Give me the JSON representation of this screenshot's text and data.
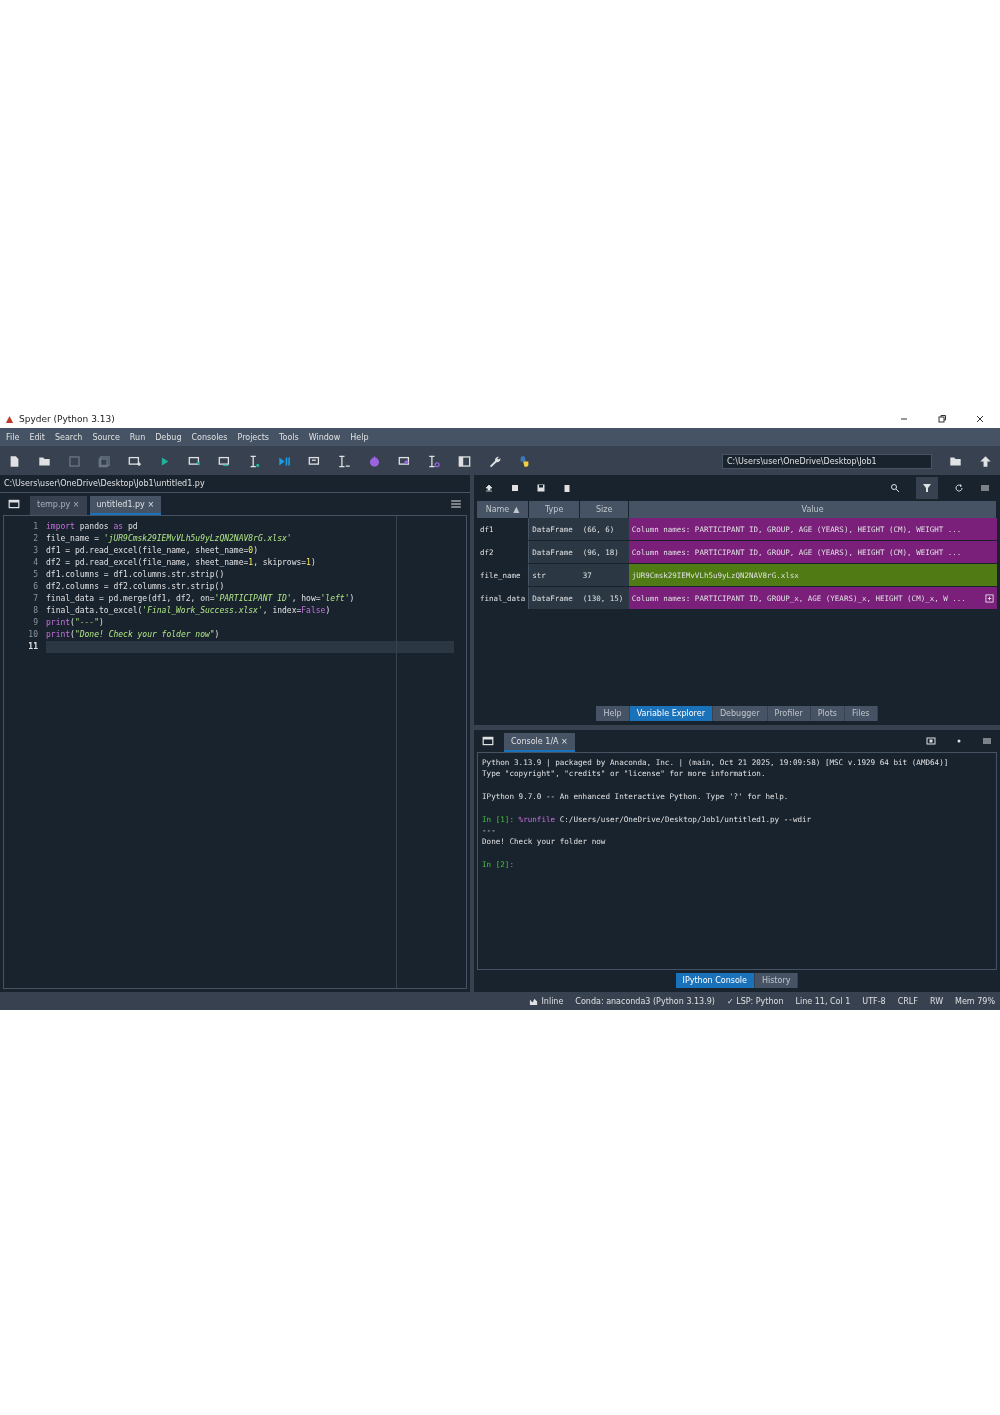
{
  "window": {
    "title": "Spyder (Python 3.13)"
  },
  "menu": [
    "File",
    "Edit",
    "Search",
    "Source",
    "Run",
    "Debug",
    "Consoles",
    "Projects",
    "Tools",
    "Window",
    "Help"
  ],
  "working_directory": {
    "value": "C:\\Users\\user\\OneDrive\\Desktop\\Job1"
  },
  "editor": {
    "path": "C:\\Users\\user\\OneDrive\\Desktop\\Job1\\untitled1.py",
    "tabs": [
      {
        "label": "temp.py",
        "close": "×",
        "selected": false
      },
      {
        "label": "untitled1.py",
        "close": "×",
        "selected": true
      }
    ],
    "lines": [
      {
        "number": "1",
        "current": false,
        "tokens": [
          {
            "kind": "keyword",
            "text": "import"
          },
          {
            "kind": "plain",
            "text": " pandos "
          },
          {
            "kind": "keyword",
            "text": "as"
          },
          {
            "kind": "plain",
            "text": " pd"
          }
        ]
      },
      {
        "number": "2",
        "current": false,
        "tokens": [
          {
            "kind": "plain",
            "text": "file_name = "
          },
          {
            "kind": "string",
            "text": "'jUR9Cmsk29IEMvVLh5u9yLzQN2NAV8rG.xlsx'"
          }
        ]
      },
      {
        "number": "3",
        "current": false,
        "tokens": [
          {
            "kind": "plain",
            "text": "df1 = pd.read_excel(file_name, sheet_name="
          },
          {
            "kind": "number",
            "text": "0"
          },
          {
            "kind": "plain",
            "text": ")"
          }
        ]
      },
      {
        "number": "4",
        "current": false,
        "tokens": [
          {
            "kind": "plain",
            "text": "df2 = pd.read_excel(file_name, sheet_name="
          },
          {
            "kind": "number",
            "text": "1"
          },
          {
            "kind": "plain",
            "text": ", skiprows="
          },
          {
            "kind": "number",
            "text": "1"
          },
          {
            "kind": "plain",
            "text": ")"
          }
        ]
      },
      {
        "number": "5",
        "current": false,
        "tokens": [
          {
            "kind": "plain",
            "text": "df1.columns = df1.columns.str.strip()"
          }
        ]
      },
      {
        "number": "6",
        "current": false,
        "tokens": [
          {
            "kind": "plain",
            "text": "df2.columns = df2.columns.str.strip()"
          }
        ]
      },
      {
        "number": "7",
        "current": false,
        "tokens": [
          {
            "kind": "plain",
            "text": "final_data = pd.merge(df1, df2, on="
          },
          {
            "kind": "string",
            "text": "'PARTICIPANT ID'"
          },
          {
            "kind": "plain",
            "text": ", how="
          },
          {
            "kind": "string",
            "text": "'left'"
          },
          {
            "kind": "plain",
            "text": ")"
          }
        ]
      },
      {
        "number": "8",
        "current": false,
        "tokens": [
          {
            "kind": "plain",
            "text": "final_data.to_excel("
          },
          {
            "kind": "string",
            "text": "'Final_Work_Success.xlsx'"
          },
          {
            "kind": "plain",
            "text": ", index="
          },
          {
            "kind": "keyword",
            "text": "False"
          },
          {
            "kind": "plain",
            "text": ")"
          }
        ]
      },
      {
        "number": "9",
        "current": false,
        "tokens": [
          {
            "kind": "keyword",
            "text": "print"
          },
          {
            "kind": "plain",
            "text": "("
          },
          {
            "kind": "string",
            "text": "\"---\""
          },
          {
            "kind": "plain",
            "text": ")"
          }
        ]
      },
      {
        "number": "10",
        "current": false,
        "tokens": [
          {
            "kind": "keyword",
            "text": "print"
          },
          {
            "kind": "plain",
            "text": "("
          },
          {
            "kind": "string",
            "text": "\"Done! Check your folder now\""
          },
          {
            "kind": "plain",
            "text": ")"
          }
        ]
      },
      {
        "number": "11",
        "current": true
      }
    ]
  },
  "variable_explorer": {
    "columns": [
      {
        "label": "Name",
        "sort": "▲"
      },
      {
        "label": "Type"
      },
      {
        "label": "Size"
      },
      {
        "label": "Value"
      }
    ],
    "rows": [
      {
        "name": "df1",
        "type": "DataFrame",
        "size": "(66, 6)",
        "value": "Column names: PARTICIPANT ID, GROUP, AGE (YEARS), HEIGHT (CM), WEIGHT ...",
        "color": "#7a1f7a",
        "expandable": false
      },
      {
        "name": "df2",
        "type": "DataFrame",
        "size": "(96, 18)",
        "value": "Column names: PARTICIPANT ID, GROUP, AGE (YEARS), HEIGHT (CM), WEIGHT ...",
        "color": "#7a1f7a",
        "expandable": false
      },
      {
        "name": "file_name",
        "type": "str",
        "size": "37",
        "value": "jUR9Cmsk29IEMvVLh5u9yLzQN2NAV8rG.xlsx",
        "color": "#4f7a14",
        "expandable": false
      },
      {
        "name": "final_data",
        "type": "DataFrame",
        "size": "(130, 15)",
        "value": "Column names: PARTICIPANT ID, GROUP_x, AGE (YEARS)_x, HEIGHT (CM)_x, W ...",
        "color": "#7a1f7a",
        "expandable": true
      }
    ]
  },
  "pane_tabs": [
    {
      "label": "Help",
      "selected": false
    },
    {
      "label": "Variable Explorer",
      "selected": true
    },
    {
      "label": "Debugger",
      "selected": false
    },
    {
      "label": "Profiler",
      "selected": false
    },
    {
      "label": "Plots",
      "selected": false
    },
    {
      "label": "Files",
      "selected": false
    }
  ],
  "console": {
    "tabs": [
      {
        "label": "Console 1/A",
        "close": "×",
        "selected": true
      }
    ],
    "blocks": [
      {
        "lines": [
          {
            "tokens": [
              {
                "kind": "plain",
                "text": "Python 3.13.9 | packaged by Anaconda, Inc. | (main, Oct 21 2025, 19:09:58) [MSC v.1929 64 bit (AMD64)]"
              }
            ]
          },
          {
            "tokens": [
              {
                "kind": "plain",
                "text": "Type \"copyright\", \"credits\" or \"license\" for more information."
              }
            ]
          }
        ]
      },
      {
        "lines": [
          {
            "tokens": [
              {
                "kind": "plain",
                "text": "IPython 9.7.0 -- An enhanced Interactive Python. Type '?' for help."
              }
            ]
          }
        ]
      },
      {
        "lines": [
          {
            "tokens": [
              {
                "kind": "prompt",
                "text": "In [1]: "
              },
              {
                "kind": "magic",
                "text": "%runfile"
              },
              {
                "kind": "plain",
                "text": " C:/Users/user/OneDrive/Desktop/Job1/untitled1.py --wdir"
              }
            ]
          },
          {
            "tokens": [
              {
                "kind": "plain",
                "text": "---"
              }
            ]
          },
          {
            "tokens": [
              {
                "kind": "plain",
                "text": "Done! Check your folder now"
              }
            ]
          }
        ]
      },
      {
        "lines": [
          {
            "tokens": [
              {
                "kind": "prompt",
                "text": "In [2]: "
              }
            ]
          }
        ]
      }
    ]
  },
  "console_tabs": [
    {
      "label": "IPython Console",
      "selected": true
    },
    {
      "label": "History",
      "selected": false
    }
  ],
  "status_bar": [
    {
      "kind": "inline",
      "text": "Inline"
    },
    {
      "kind": "text",
      "text": "Conda: anaconda3 (Python 3.13.9)"
    },
    {
      "kind": "text",
      "text": "✓ LSP: Python"
    },
    {
      "kind": "text",
      "text": "Line 11, Col 1"
    },
    {
      "kind": "text",
      "text": "UTF-8"
    },
    {
      "kind": "text",
      "text": "CRLF"
    },
    {
      "kind": "text",
      "text": "RW"
    },
    {
      "kind": "text",
      "text": "Mem 79%"
    }
  ]
}
